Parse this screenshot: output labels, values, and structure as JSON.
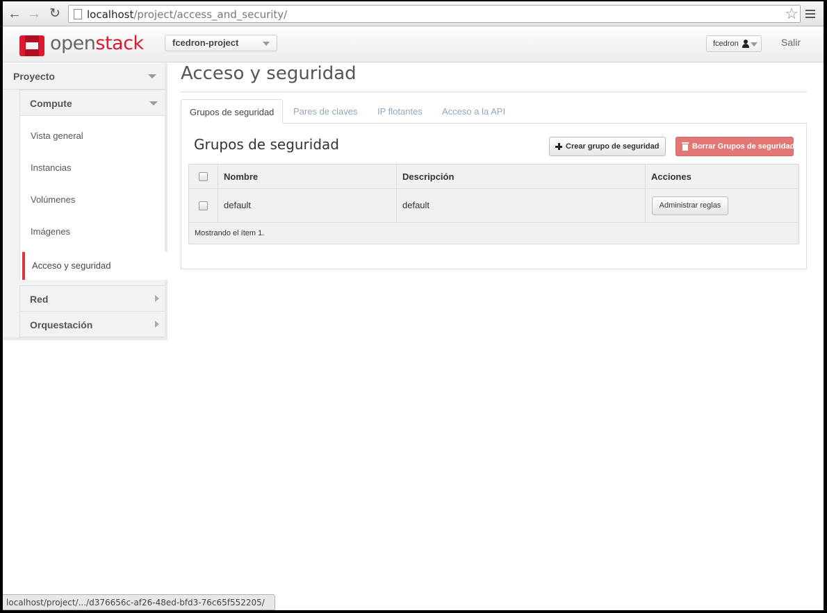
{
  "browser": {
    "url_host": "localhost",
    "url_path": "/project/access_and_security/",
    "status_url": "localhost/project/.../d376656c-af26-48ed-bfd3-76c65f552205/"
  },
  "header": {
    "logo_text_a": "open",
    "logo_text_b": "stack",
    "project": "fcedron-project",
    "user": "fcedron",
    "logout": "Salir"
  },
  "sidebar": {
    "dashboard": "Proyecto",
    "panel_group": "Compute",
    "items": [
      "Vista general",
      "Instancias",
      "Volúmenes",
      "Imágenes"
    ],
    "active_item": "Acceso y seguridad",
    "collapsed_groups": [
      "Red",
      "Orquestación"
    ]
  },
  "page": {
    "title": "Acceso y seguridad",
    "tabs": [
      "Grupos de seguridad",
      "Pares de claves",
      "IP flotantes",
      "Acceso a la API"
    ],
    "section_title": "Grupos de seguridad",
    "create_button": "Crear grupo de seguridad",
    "delete_button": "Borrar Grupos de seguridad",
    "columns": [
      "Nombre",
      "Descripción",
      "Acciones"
    ],
    "rows": [
      {
        "name": "default",
        "description": "default",
        "action": "Administrar reglas"
      }
    ],
    "footer": "Mostrando el ítem 1."
  },
  "colors": {
    "brand": "#da1a32",
    "active_indicator": "#d9363d",
    "danger_button": "#e27775",
    "inactive_tab": "#8fa7bd"
  }
}
